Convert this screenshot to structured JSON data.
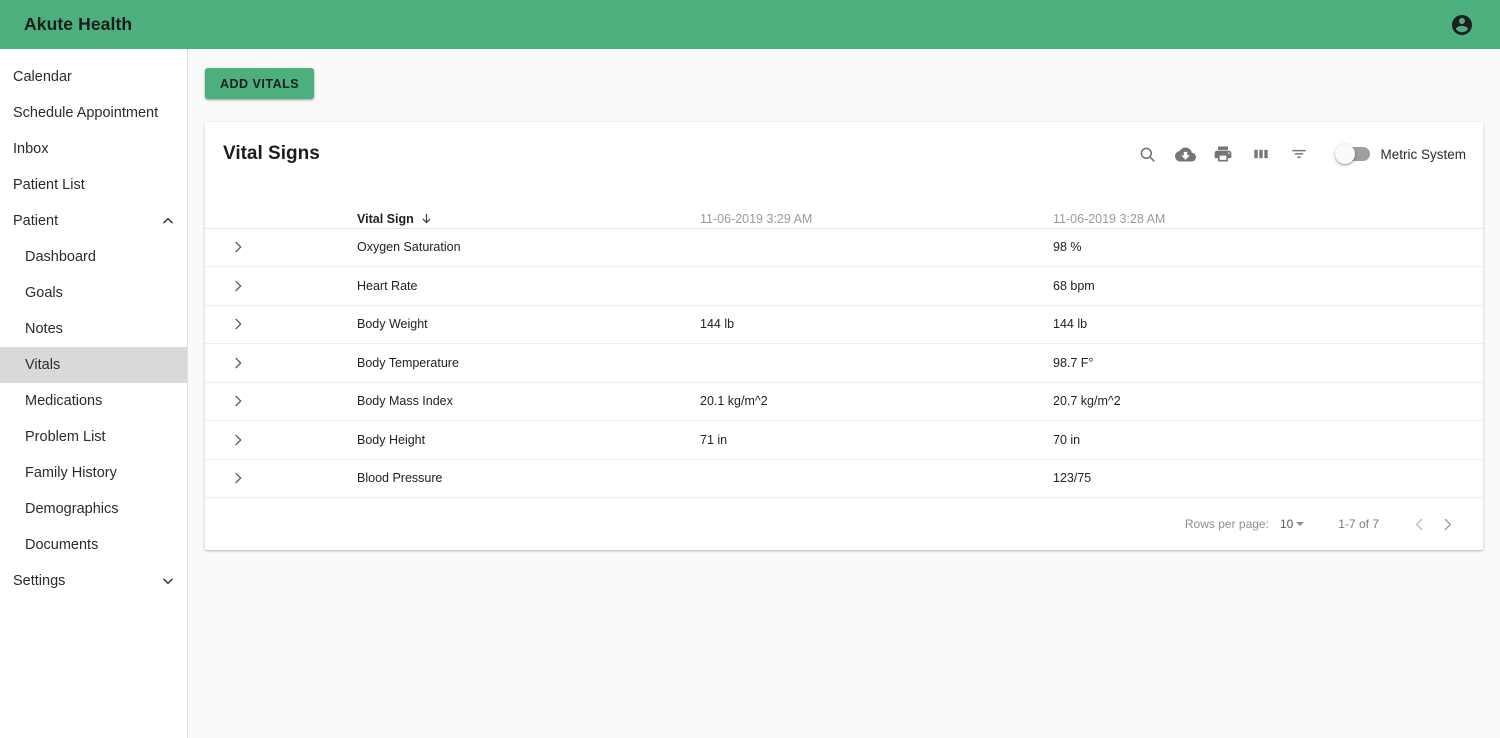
{
  "app": {
    "title": "Akute Health",
    "account_icon": "account-circle-icon",
    "brand_color": "#4caf7d"
  },
  "sidebar": {
    "items": [
      {
        "label": "Calendar",
        "level": "top",
        "icon": null,
        "active": false
      },
      {
        "label": "Schedule Appointment",
        "level": "top",
        "icon": null,
        "active": false
      },
      {
        "label": "Inbox",
        "level": "top",
        "icon": null,
        "active": false
      },
      {
        "label": "Patient List",
        "level": "top",
        "icon": null,
        "active": false
      },
      {
        "label": "Patient",
        "level": "top",
        "icon": "chevron-up-icon",
        "active": false
      },
      {
        "label": "Dashboard",
        "level": "child",
        "icon": null,
        "active": false
      },
      {
        "label": "Goals",
        "level": "child",
        "icon": null,
        "active": false
      },
      {
        "label": "Notes",
        "level": "child",
        "icon": null,
        "active": false
      },
      {
        "label": "Vitals",
        "level": "child",
        "icon": null,
        "active": true
      },
      {
        "label": "Medications",
        "level": "child",
        "icon": null,
        "active": false
      },
      {
        "label": "Problem List",
        "level": "child",
        "icon": null,
        "active": false
      },
      {
        "label": "Family History",
        "level": "child",
        "icon": null,
        "active": false
      },
      {
        "label": "Demographics",
        "level": "child",
        "icon": null,
        "active": false
      },
      {
        "label": "Documents",
        "level": "child",
        "icon": null,
        "active": false
      },
      {
        "label": "Settings",
        "level": "top",
        "icon": "chevron-down-icon",
        "active": false
      }
    ]
  },
  "main": {
    "add_vitals_label": "ADD VITALS",
    "card": {
      "title": "Vital Signs",
      "toolbar_icons": [
        "search-icon",
        "cloud-download-icon",
        "print-icon",
        "view-column-icon",
        "filter-list-icon"
      ],
      "metric_toggle": {
        "label": "Metric System",
        "checked": false
      },
      "table": {
        "columns": [
          {
            "label": "",
            "type": "expand"
          },
          {
            "label": "Vital Sign",
            "type": "sortable",
            "sort": "desc",
            "sort_icon": "arrow-downward-icon"
          },
          {
            "label": "11-06-2019 3:29 AM",
            "type": "date"
          },
          {
            "label": "11-06-2019 3:28 AM",
            "type": "date"
          }
        ],
        "rows": [
          {
            "expand_icon": "chevron-right-icon",
            "name": "Oxygen Saturation",
            "v1": "",
            "v2": "98 %"
          },
          {
            "expand_icon": "chevron-right-icon",
            "name": "Heart Rate",
            "v1": "",
            "v2": "68 bpm"
          },
          {
            "expand_icon": "chevron-right-icon",
            "name": "Body Weight",
            "v1": "144 lb",
            "v2": "144 lb"
          },
          {
            "expand_icon": "chevron-right-icon",
            "name": "Body Temperature",
            "v1": "",
            "v2": "98.7 F°"
          },
          {
            "expand_icon": "chevron-right-icon",
            "name": "Body Mass Index",
            "v1": "20.1 kg/m^2",
            "v2": "20.7 kg/m^2"
          },
          {
            "expand_icon": "chevron-right-icon",
            "name": "Body Height",
            "v1": "71 in",
            "v2": "70 in"
          },
          {
            "expand_icon": "chevron-right-icon",
            "name": "Blood Pressure",
            "v1": "",
            "v2": "123/75"
          }
        ]
      },
      "pagination": {
        "rows_per_page_label": "Rows per page:",
        "rows_per_page_value": "10",
        "range_label": "1-7 of 7",
        "prev_icon": "chevron-left-icon",
        "next_icon": "chevron-right-icon"
      }
    }
  }
}
